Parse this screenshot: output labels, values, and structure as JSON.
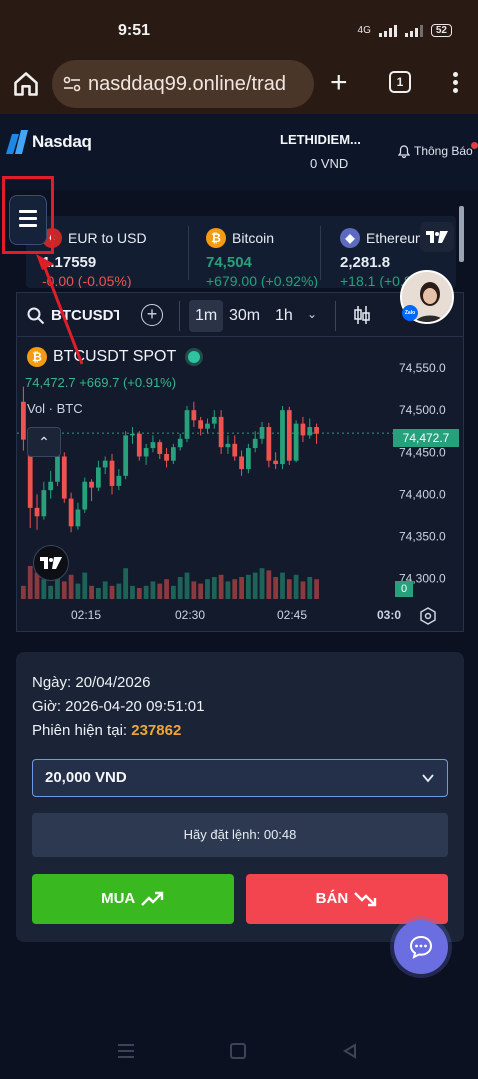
{
  "status_bar": {
    "time": "9:51",
    "network": "4G",
    "battery": "52"
  },
  "browser": {
    "url": "nasddaq99.online/trad",
    "tab_count": "1"
  },
  "header": {
    "logo": "Nasdaq",
    "username": "LETHIDIEM...",
    "balance": "0 VND",
    "notification_label": "Thông Báo"
  },
  "ticker": [
    {
      "name": "EUR to USD",
      "price": "1.17559",
      "change": "-0.00 (-0.05%)",
      "direction": "down",
      "icon": "euro-flag-icon"
    },
    {
      "name": "Bitcoin",
      "price": "74,504",
      "change": "+679.00 (+0.92%)",
      "direction": "up",
      "icon": "bitcoin-icon"
    },
    {
      "name": "Ethereum",
      "price": "2,281.8",
      "change": "+18.1 (+0.8",
      "direction": "up",
      "icon": "ethereum-icon"
    }
  ],
  "chart_toolbar": {
    "symbol": "BTCUSDT",
    "intervals": [
      "1m",
      "30m",
      "1h"
    ],
    "active_interval": "1m"
  },
  "chart": {
    "title": "BTCUSDT SPOT",
    "ohlc": "74,472.7  +669.7 (+0.91%)",
    "volume_label": "Vol · BTC",
    "current_price_tag": "74,472.7",
    "volume_tag": "0",
    "badge_text": "Zalo"
  },
  "chart_data": {
    "type": "candlestick",
    "title": "BTCUSDT SPOT",
    "xlabel": "",
    "ylabel": "",
    "x_ticks": [
      "02:15",
      "02:30",
      "02:45",
      "03:0"
    ],
    "y_ticks": [
      "74,550.0",
      "74,500.0",
      "74,450.0",
      "74,400.0",
      "74,350.0",
      "74,300.0"
    ],
    "ylim": [
      74290,
      74575
    ],
    "current_price": 74472.7,
    "candles": [
      {
        "o": 74510,
        "h": 74528,
        "c": 74465,
        "l": 74452
      },
      {
        "o": 74465,
        "h": 74470,
        "c": 74384,
        "l": 74360
      },
      {
        "o": 74384,
        "h": 74400,
        "c": 74374,
        "l": 74358
      },
      {
        "o": 74374,
        "h": 74415,
        "c": 74405,
        "l": 74370
      },
      {
        "o": 74405,
        "h": 74428,
        "c": 74415,
        "l": 74395
      },
      {
        "o": 74415,
        "h": 74455,
        "c": 74445,
        "l": 74410
      },
      {
        "o": 74445,
        "h": 74450,
        "c": 74395,
        "l": 74390
      },
      {
        "o": 74395,
        "h": 74402,
        "c": 74362,
        "l": 74355
      },
      {
        "o": 74362,
        "h": 74390,
        "c": 74382,
        "l": 74358
      },
      {
        "o": 74382,
        "h": 74420,
        "c": 74415,
        "l": 74378
      },
      {
        "o": 74415,
        "h": 74418,
        "c": 74408,
        "l": 74392
      },
      {
        "o": 74408,
        "h": 74440,
        "c": 74432,
        "l": 74404
      },
      {
        "o": 74432,
        "h": 74445,
        "c": 74440,
        "l": 74424
      },
      {
        "o": 74440,
        "h": 74448,
        "c": 74410,
        "l": 74400
      },
      {
        "o": 74410,
        "h": 74430,
        "c": 74422,
        "l": 74405
      },
      {
        "o": 74422,
        "h": 74475,
        "c": 74470,
        "l": 74418
      },
      {
        "o": 74470,
        "h": 74480,
        "c": 74472,
        "l": 74460
      },
      {
        "o": 74472,
        "h": 74475,
        "c": 74445,
        "l": 74440
      },
      {
        "o": 74445,
        "h": 74460,
        "c": 74455,
        "l": 74435
      },
      {
        "o": 74455,
        "h": 74470,
        "c": 74462,
        "l": 74450
      },
      {
        "o": 74462,
        "h": 74465,
        "c": 74448,
        "l": 74442
      },
      {
        "o": 74448,
        "h": 74455,
        "c": 74440,
        "l": 74432
      },
      {
        "o": 74440,
        "h": 74460,
        "c": 74456,
        "l": 74436
      },
      {
        "o": 74456,
        "h": 74472,
        "c": 74466,
        "l": 74452
      },
      {
        "o": 74466,
        "h": 74505,
        "c": 74500,
        "l": 74462
      },
      {
        "o": 74500,
        "h": 74510,
        "c": 74488,
        "l": 74480
      },
      {
        "o": 74488,
        "h": 74492,
        "c": 74478,
        "l": 74470
      },
      {
        "o": 74478,
        "h": 74490,
        "c": 74484,
        "l": 74472
      },
      {
        "o": 74484,
        "h": 74500,
        "c": 74492,
        "l": 74478
      },
      {
        "o": 74492,
        "h": 74500,
        "c": 74456,
        "l": 74448
      },
      {
        "o": 74456,
        "h": 74470,
        "c": 74460,
        "l": 74448
      },
      {
        "o": 74460,
        "h": 74470,
        "c": 74445,
        "l": 74440
      },
      {
        "o": 74445,
        "h": 74452,
        "c": 74430,
        "l": 74422
      },
      {
        "o": 74430,
        "h": 74460,
        "c": 74455,
        "l": 74425
      },
      {
        "o": 74455,
        "h": 74475,
        "c": 74466,
        "l": 74450
      },
      {
        "o": 74466,
        "h": 74486,
        "c": 74480,
        "l": 74460
      },
      {
        "o": 74480,
        "h": 74485,
        "c": 74440,
        "l": 74432
      },
      {
        "o": 74440,
        "h": 74450,
        "c": 74436,
        "l": 74430
      },
      {
        "o": 74436,
        "h": 74505,
        "c": 74500,
        "l": 74430
      },
      {
        "o": 74500,
        "h": 74504,
        "c": 74440,
        "l": 74435
      },
      {
        "o": 74440,
        "h": 74488,
        "c": 74484,
        "l": 74438
      },
      {
        "o": 74484,
        "h": 74492,
        "c": 74470,
        "l": 74462
      },
      {
        "o": 74470,
        "h": 74490,
        "c": 74480,
        "l": 74466
      },
      {
        "o": 74480,
        "h": 74484,
        "c": 74472,
        "l": 74460
      }
    ],
    "volume_relative": [
      0.3,
      0.75,
      0.6,
      0.45,
      0.3,
      0.5,
      0.4,
      0.55,
      0.35,
      0.6,
      0.3,
      0.25,
      0.4,
      0.3,
      0.35,
      0.7,
      0.3,
      0.25,
      0.3,
      0.4,
      0.35,
      0.45,
      0.3,
      0.5,
      0.6,
      0.4,
      0.35,
      0.45,
      0.5,
      0.55,
      0.4,
      0.45,
      0.5,
      0.55,
      0.6,
      0.7,
      0.65,
      0.5,
      0.6,
      0.45,
      0.55,
      0.4,
      0.5,
      0.45
    ]
  },
  "order": {
    "date_label": "Ngày: 20/04/2026",
    "time_label": "Giờ: 2026-04-20 09:51:01",
    "session_label": "Phiên hiện tại:",
    "session_number": "237862",
    "amount": "20,000 VND",
    "countdown": "Hãy đặt lệnh: 00:48",
    "buy_label": "MUA",
    "sell_label": "BÁN"
  },
  "colors": {
    "up": "#26a17b",
    "down": "#ef5350",
    "buy": "#39b81f",
    "sell": "#f2454f",
    "session": "#f0a53a",
    "annotation": "#e11d2a"
  }
}
